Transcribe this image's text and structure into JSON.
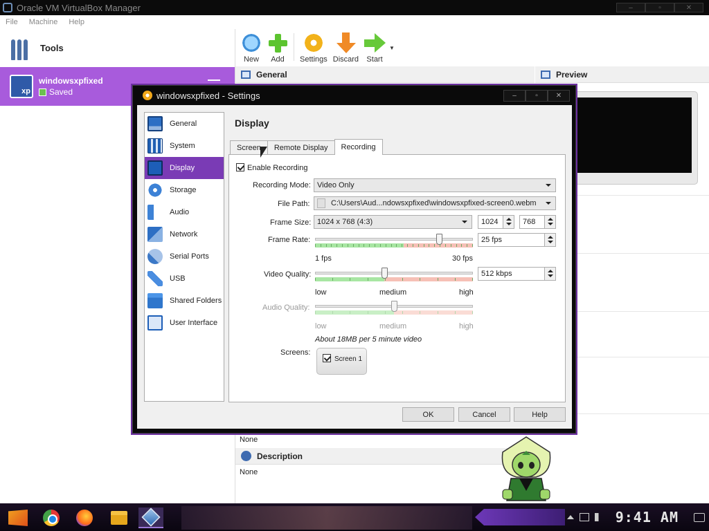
{
  "window": {
    "title": "Oracle VM VirtualBox Manager",
    "controls": {
      "minimize": "–",
      "maximize": "▫",
      "close": "✕"
    }
  },
  "menu": [
    "File",
    "Machine",
    "Help"
  ],
  "tools": {
    "label": "Tools",
    "icon": "tools-icon"
  },
  "vm": {
    "name": "windowsxpfixed",
    "state": "Saved",
    "badge_top": "64",
    "badge_bottom": "xp",
    "accent": "#a85bdc"
  },
  "toolbar": {
    "new_label": "New",
    "add_label": "Add",
    "settings_label": "Settings",
    "discard_label": "Discard",
    "start_label": "Start"
  },
  "details": {
    "general_label": "General",
    "preview_label": "Preview",
    "description_label": "Description",
    "shared_folders_value": "None",
    "description_value": "None"
  },
  "dialog": {
    "title": "windowsxpfixed - Settings",
    "controls": {
      "minimize": "–",
      "maximize": "▫",
      "close": "✕"
    },
    "page_title": "Display",
    "side_items": [
      {
        "label": "General",
        "icon": "monitor-icon"
      },
      {
        "label": "System",
        "icon": "chip-icon"
      },
      {
        "label": "Display",
        "icon": "display-icon"
      },
      {
        "label": "Storage",
        "icon": "disk-icon"
      },
      {
        "label": "Audio",
        "icon": "speaker-icon"
      },
      {
        "label": "Network",
        "icon": "network-icon"
      },
      {
        "label": "Serial Ports",
        "icon": "serial-port-icon"
      },
      {
        "label": "USB",
        "icon": "usb-icon"
      },
      {
        "label": "Shared Folders",
        "icon": "folder-icon"
      },
      {
        "label": "User Interface",
        "icon": "window-icon"
      }
    ],
    "active_side_item": "Display",
    "tabs": [
      "Screen",
      "Remote Display",
      "Recording"
    ],
    "active_tab": "Recording",
    "recording": {
      "enable_label": "Enable Recording",
      "enabled": true,
      "mode_label": "Recording Mode:",
      "mode_value": "Video Only",
      "file_path_label": "File Path:",
      "file_path_value": "C:\\Users\\Aud...ndowsxpfixed\\windowsxpfixed-screen0.webm",
      "frame_size_label": "Frame Size:",
      "frame_size_value": "1024 x 768 (4:3)",
      "frame_width": "1024",
      "frame_height": "768",
      "frame_rate_label": "Frame Rate:",
      "frame_rate_value": "25 fps",
      "frame_rate_fraction": 0.8,
      "frame_rate_min": "1 fps",
      "frame_rate_max": "30 fps",
      "video_quality_label": "Video Quality:",
      "video_quality_value": "512 kbps",
      "video_quality_fraction": 0.44,
      "audio_quality_label": "Audio Quality:",
      "audio_quality_fraction": 0.5,
      "quality_low": "low",
      "quality_medium": "medium",
      "quality_high": "high",
      "size_estimate": "About 18MB per 5 minute video",
      "screens_label": "Screens:",
      "screen_1_label": "Screen 1",
      "screen_1_checked": true
    },
    "buttons": {
      "ok": "OK",
      "cancel": "Cancel",
      "help": "Help"
    },
    "accent": "#7a3bb5"
  },
  "taskbar": {
    "apps": [
      {
        "name": "start-icon"
      },
      {
        "name": "chrome-icon"
      },
      {
        "name": "firefox-icon"
      },
      {
        "name": "file-explorer-icon"
      },
      {
        "name": "virtualbox-icon"
      }
    ],
    "clock": "9:41 AM"
  }
}
